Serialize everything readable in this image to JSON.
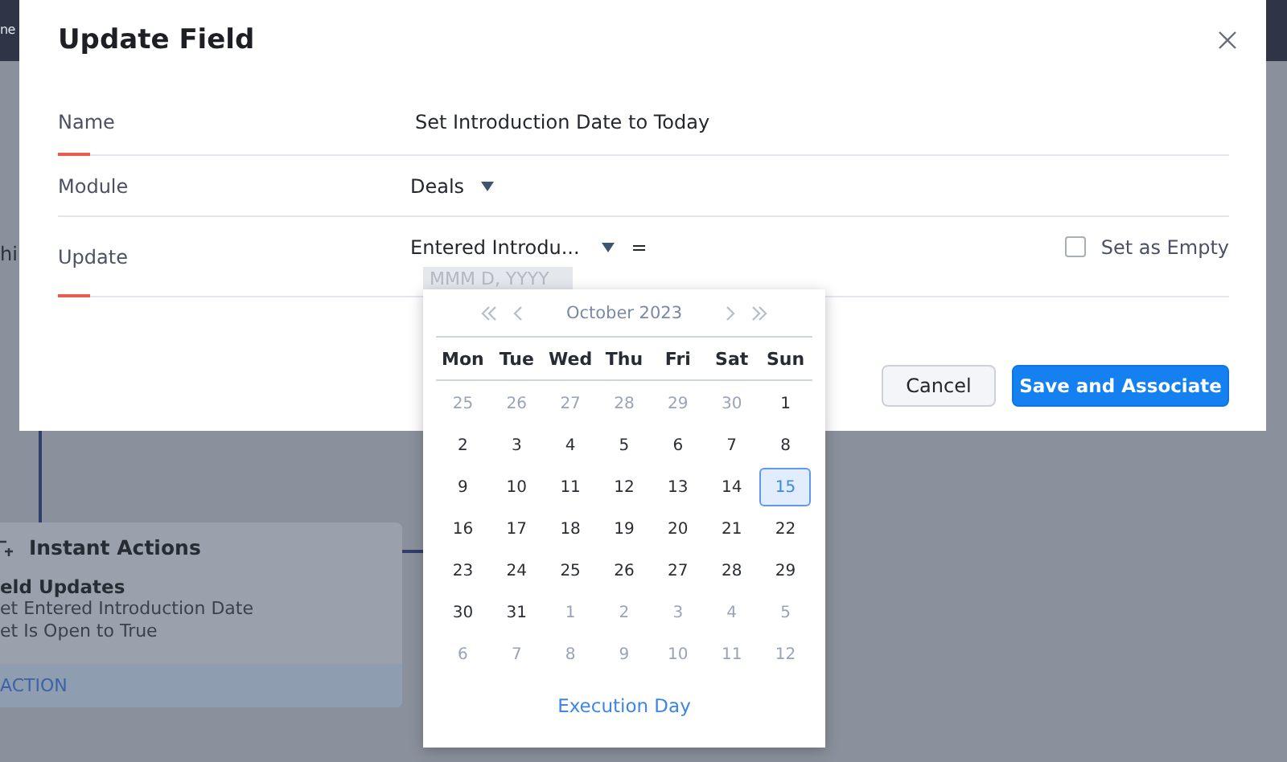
{
  "background": {
    "topbar_text": "ne",
    "side_text": "hi",
    "card": {
      "title": "Instant Actions",
      "heading": "eld Updates",
      "lines": [
        "et Entered Introduction Date",
        "et Is Open to True"
      ],
      "footer": "ACTION"
    }
  },
  "dialog": {
    "title": "Update Field",
    "fields": [
      {
        "label": "Name",
        "kind": "text",
        "value": "Set Introduction Date to Today",
        "required": true
      },
      {
        "label": "Module",
        "kind": "select",
        "value": "Deals",
        "required": false
      },
      {
        "label": "Update",
        "kind": "update",
        "value": "Entered Introdu...",
        "operator": "=",
        "placeholder": "MMM D, YYYY",
        "required": true
      }
    ],
    "set_empty": {
      "label": "Set as Empty",
      "checked": false
    },
    "buttons": [
      {
        "label": "Cancel",
        "kind": "secondary"
      },
      {
        "label": "Save and Associate",
        "kind": "primary"
      }
    ]
  },
  "calendar": {
    "month": "October 2023",
    "weekdays": [
      "Mon",
      "Tue",
      "Wed",
      "Thu",
      "Fri",
      "Sat",
      "Sun"
    ],
    "weeks": [
      [
        {
          "day": "25",
          "other": true,
          "selected": false
        },
        {
          "day": "26",
          "other": true,
          "selected": false
        },
        {
          "day": "27",
          "other": true,
          "selected": false
        },
        {
          "day": "28",
          "other": true,
          "selected": false
        },
        {
          "day": "29",
          "other": true,
          "selected": false
        },
        {
          "day": "30",
          "other": true,
          "selected": false
        },
        {
          "day": "1",
          "other": false,
          "selected": false
        }
      ],
      [
        {
          "day": "2",
          "other": false,
          "selected": false
        },
        {
          "day": "3",
          "other": false,
          "selected": false
        },
        {
          "day": "4",
          "other": false,
          "selected": false
        },
        {
          "day": "5",
          "other": false,
          "selected": false
        },
        {
          "day": "6",
          "other": false,
          "selected": false
        },
        {
          "day": "7",
          "other": false,
          "selected": false
        },
        {
          "day": "8",
          "other": false,
          "selected": false
        }
      ],
      [
        {
          "day": "9",
          "other": false,
          "selected": false
        },
        {
          "day": "10",
          "other": false,
          "selected": false
        },
        {
          "day": "11",
          "other": false,
          "selected": false
        },
        {
          "day": "12",
          "other": false,
          "selected": false
        },
        {
          "day": "13",
          "other": false,
          "selected": false
        },
        {
          "day": "14",
          "other": false,
          "selected": false
        },
        {
          "day": "15",
          "other": false,
          "selected": true
        }
      ],
      [
        {
          "day": "16",
          "other": false,
          "selected": false
        },
        {
          "day": "17",
          "other": false,
          "selected": false
        },
        {
          "day": "18",
          "other": false,
          "selected": false
        },
        {
          "day": "19",
          "other": false,
          "selected": false
        },
        {
          "day": "20",
          "other": false,
          "selected": false
        },
        {
          "day": "21",
          "other": false,
          "selected": false
        },
        {
          "day": "22",
          "other": false,
          "selected": false
        }
      ],
      [
        {
          "day": "23",
          "other": false,
          "selected": false
        },
        {
          "day": "24",
          "other": false,
          "selected": false
        },
        {
          "day": "25",
          "other": false,
          "selected": false
        },
        {
          "day": "26",
          "other": false,
          "selected": false
        },
        {
          "day": "27",
          "other": false,
          "selected": false
        },
        {
          "day": "28",
          "other": false,
          "selected": false
        },
        {
          "day": "29",
          "other": false,
          "selected": false
        }
      ],
      [
        {
          "day": "30",
          "other": false,
          "selected": false
        },
        {
          "day": "31",
          "other": false,
          "selected": false
        },
        {
          "day": "1",
          "other": true,
          "selected": false
        },
        {
          "day": "2",
          "other": true,
          "selected": false
        },
        {
          "day": "3",
          "other": true,
          "selected": false
        },
        {
          "day": "4",
          "other": true,
          "selected": false
        },
        {
          "day": "5",
          "other": true,
          "selected": false
        }
      ],
      [
        {
          "day": "6",
          "other": true,
          "selected": false
        },
        {
          "day": "7",
          "other": true,
          "selected": false
        },
        {
          "day": "8",
          "other": true,
          "selected": false
        },
        {
          "day": "9",
          "other": true,
          "selected": false
        },
        {
          "day": "10",
          "other": true,
          "selected": false
        },
        {
          "day": "11",
          "other": true,
          "selected": false
        },
        {
          "day": "12",
          "other": true,
          "selected": false
        }
      ]
    ],
    "footer": "Execution Day"
  }
}
